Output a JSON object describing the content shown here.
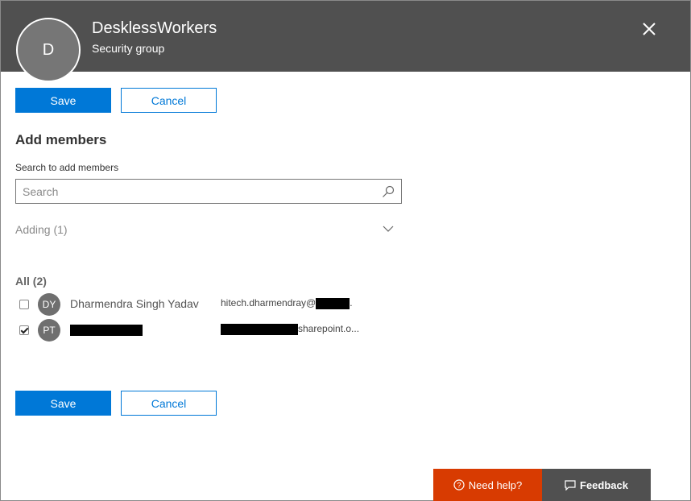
{
  "header": {
    "avatar_initial": "D",
    "group_name": "DesklessWorkers",
    "group_type": "Security group"
  },
  "actions": {
    "save_label": "Save",
    "cancel_label": "Cancel"
  },
  "add_members": {
    "title": "Add members",
    "search_label": "Search to add members",
    "search_placeholder": "Search",
    "search_value": "",
    "adding_label": "Adding (1)"
  },
  "members": {
    "all_label": "All (2)",
    "items": [
      {
        "initials": "DY",
        "name": "Dharmendra Singh Yadav",
        "email_prefix": "hitech.dharmendray@",
        "email_suffix": ".",
        "checked": false
      },
      {
        "initials": "PT",
        "name": "",
        "email_prefix": "",
        "email_suffix": "sharepoint.o...",
        "checked": true
      }
    ]
  },
  "footer": {
    "help_label": "Need help?",
    "feedback_label": "Feedback"
  },
  "colors": {
    "header_bg": "#505050",
    "primary": "#0078d7",
    "help_bg": "#d83b01"
  },
  "icons": [
    "close-icon",
    "search-icon",
    "chevron-down-icon",
    "help-circle-icon",
    "feedback-icon"
  ]
}
